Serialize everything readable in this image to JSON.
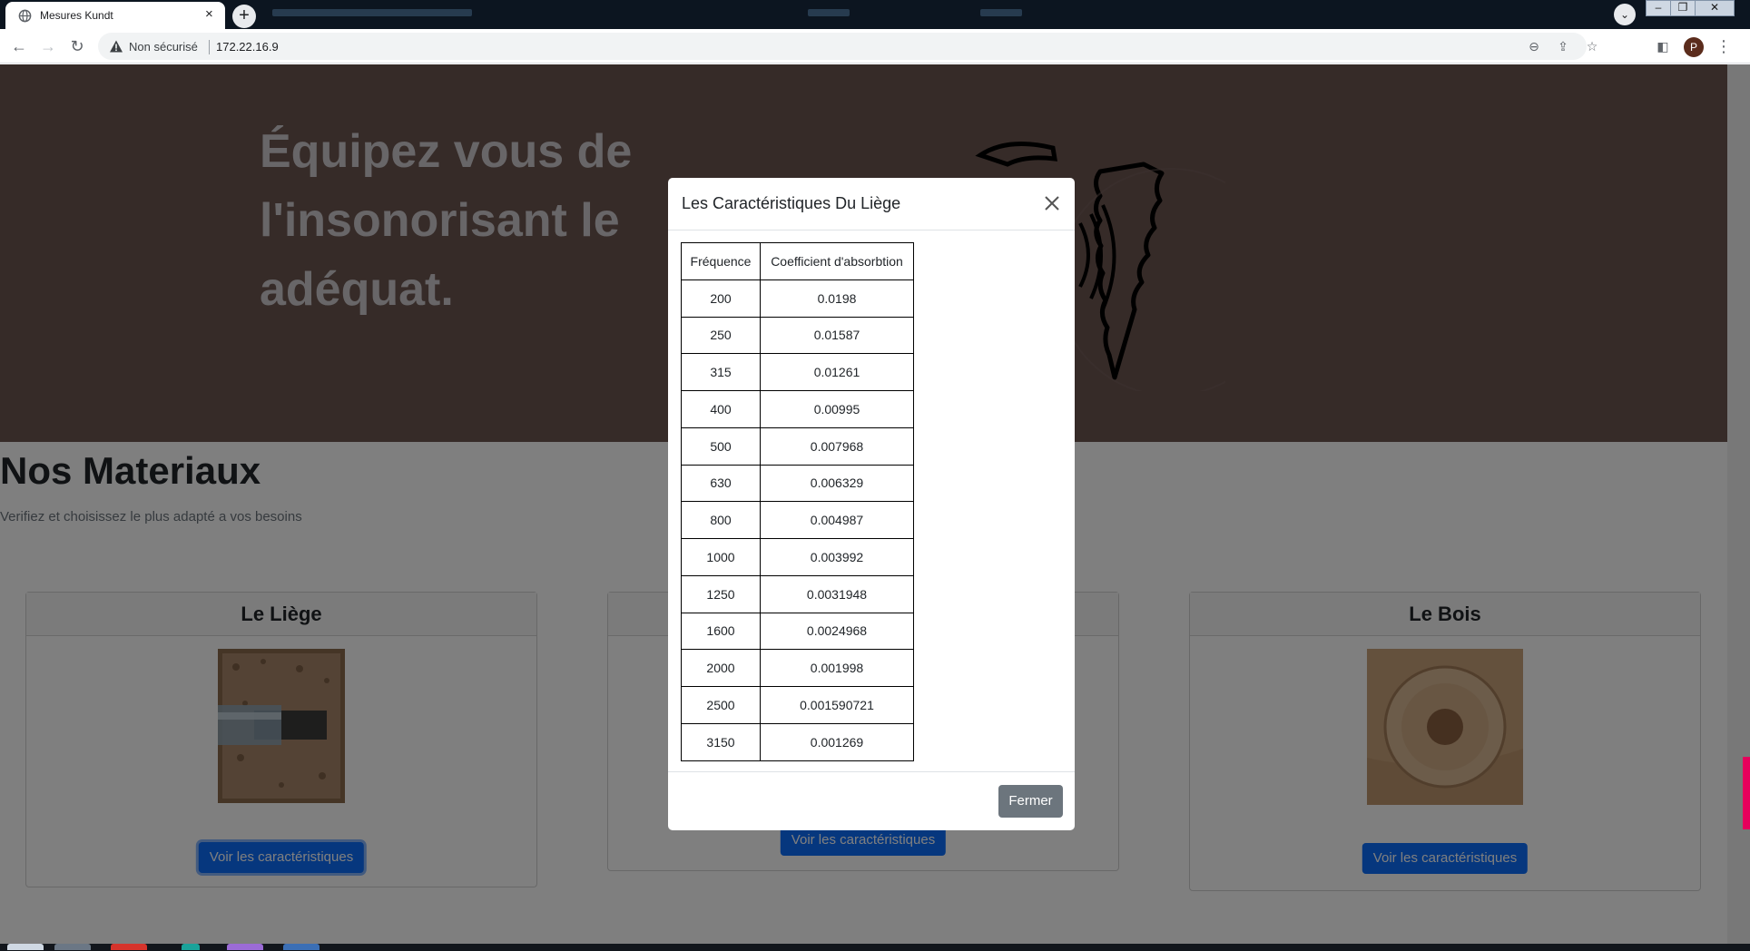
{
  "browser": {
    "tab_title": "Mesures Kundt",
    "tab_close": "×",
    "new_tab": "+",
    "security_label": "Non sécurisé",
    "url": "172.22.16.9",
    "profile_initial": "P"
  },
  "hero": {
    "headline": "Équipez vous de l'insonorisant le adéquat."
  },
  "section": {
    "title": "Nos Materiaux",
    "subtitle": "Verifiez et choisissez le plus adapté a vos besoins"
  },
  "cards": [
    {
      "title": "Le Liège",
      "button": "Voir les caractéristiques"
    },
    {
      "title": "",
      "button": "Voir les caractéristiques"
    },
    {
      "title": "Le Bois",
      "button": "Voir les caractéristiques"
    }
  ],
  "modal": {
    "title": "Les Caractéristiques Du Liège",
    "close_button": "Fermer",
    "table": {
      "headers": [
        "Fréquence",
        "Coefficient d'absorbtion"
      ],
      "rows": [
        [
          "200",
          "0.0198"
        ],
        [
          "250",
          "0.01587"
        ],
        [
          "315",
          "0.01261"
        ],
        [
          "400",
          "0.00995"
        ],
        [
          "500",
          "0.007968"
        ],
        [
          "630",
          "0.006329"
        ],
        [
          "800",
          "0.004987"
        ],
        [
          "1000",
          "0.003992"
        ],
        [
          "1250",
          "0.0031948"
        ],
        [
          "1600",
          "0.0024968"
        ],
        [
          "2000",
          "0.001998"
        ],
        [
          "2500",
          "0.001590721"
        ],
        [
          "3150",
          "0.001269"
        ]
      ]
    }
  },
  "colors": {
    "hero_bg": "#6d5650",
    "primary": "#0d6efd",
    "secondary": "#6c757d"
  }
}
